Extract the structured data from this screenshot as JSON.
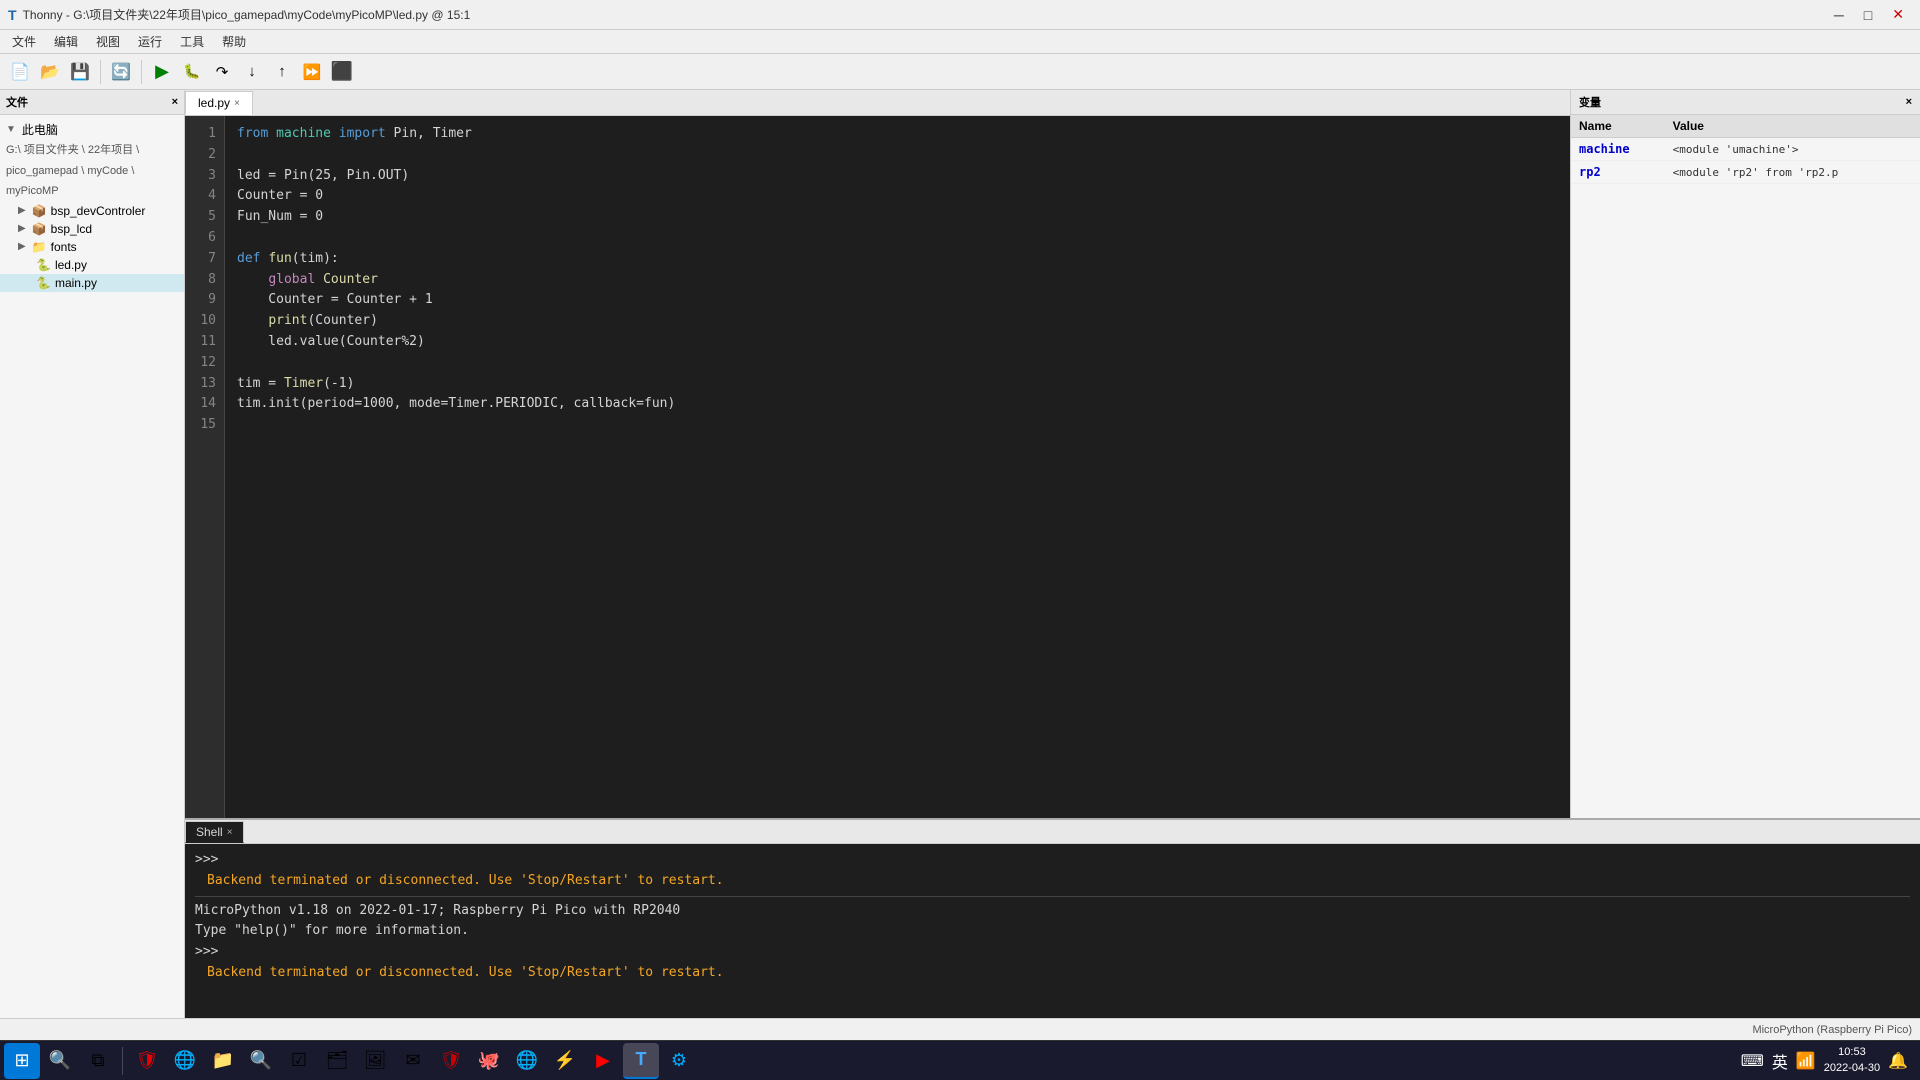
{
  "titleBar": {
    "appName": "Thonny",
    "filePath": "G:\\项目文件夹\\22年项目\\pico_gamepad\\myCode\\myPicoMP\\led.py",
    "position": "15:1",
    "minimizeLabel": "─",
    "maximizeLabel": "□",
    "closeLabel": "✕"
  },
  "menuBar": {
    "items": [
      "文件",
      "编辑",
      "视图",
      "运行",
      "工具",
      "帮助"
    ]
  },
  "toolbar": {
    "buttons": [
      {
        "name": "new-file-btn",
        "icon": "📄",
        "label": "New"
      },
      {
        "name": "open-file-btn",
        "icon": "📂",
        "label": "Open"
      },
      {
        "name": "save-file-btn",
        "icon": "💾",
        "label": "Save"
      },
      {
        "name": "new-debug-btn",
        "icon": "🔧",
        "label": "Debug"
      },
      {
        "name": "run-btn",
        "icon": "▶",
        "label": "Run"
      },
      {
        "name": "debug-btn",
        "icon": "🐞",
        "label": "Debug"
      },
      {
        "name": "step-over-btn",
        "icon": "↷",
        "label": "Step Over"
      },
      {
        "name": "step-into-btn",
        "icon": "↓",
        "label": "Step Into"
      },
      {
        "name": "step-out-btn",
        "icon": "↑",
        "label": "Step Out"
      },
      {
        "name": "resume-btn",
        "icon": "⏩",
        "label": "Resume"
      },
      {
        "name": "stop-btn",
        "icon": "⬛",
        "label": "Stop",
        "isStop": true
      }
    ]
  },
  "sidebar": {
    "header": "文件",
    "thisComputer": "此电脑",
    "path": "G:\\ 项目文件夹 \\ 22年项目 \\",
    "path2": "pico_gamepad \\ myCode \\",
    "path3": "myPicoMP",
    "items": [
      {
        "name": "bsp_devControler",
        "type": "folder",
        "expanded": false,
        "indent": 0
      },
      {
        "name": "bsp_lcd",
        "type": "folder",
        "expanded": false,
        "indent": 0
      },
      {
        "name": "fonts",
        "type": "folder",
        "expanded": false,
        "indent": 0
      },
      {
        "name": "led.py",
        "type": "file-py",
        "active": false,
        "indent": 0
      },
      {
        "name": "main.py",
        "type": "file-py",
        "active": true,
        "indent": 0
      }
    ]
  },
  "editor": {
    "tabs": [
      {
        "label": "led.py",
        "active": true,
        "closeable": true
      }
    ],
    "lines": [
      {
        "num": 1,
        "content": "from machine import Pin, Timer"
      },
      {
        "num": 2,
        "content": ""
      },
      {
        "num": 3,
        "content": "led = Pin(25, Pin.OUT)"
      },
      {
        "num": 4,
        "content": "Counter = 0"
      },
      {
        "num": 5,
        "content": "Fun_Num = 0"
      },
      {
        "num": 6,
        "content": ""
      },
      {
        "num": 7,
        "content": "def fun(tim):"
      },
      {
        "num": 8,
        "content": "    global Counter"
      },
      {
        "num": 9,
        "content": "    Counter = Counter + 1"
      },
      {
        "num": 10,
        "content": "    print(Counter)"
      },
      {
        "num": 11,
        "content": "    led.value(Counter%2)"
      },
      {
        "num": 12,
        "content": ""
      },
      {
        "num": 13,
        "content": "tim = Timer(-1)"
      },
      {
        "num": 14,
        "content": "tim.init(period=1000, mode=Timer.PERIODIC, callback=fun)"
      },
      {
        "num": 15,
        "content": ""
      }
    ]
  },
  "shell": {
    "tabLabel": "Shell",
    "lines": [
      {
        "type": "prompt",
        "text": ">>> "
      },
      {
        "type": "error",
        "text": "Backend terminated or disconnected. Use 'Stop/Restart' to restart."
      },
      {
        "type": "separator"
      },
      {
        "type": "info",
        "text": "MicroPython v1.18 on 2022-01-17; Raspberry Pi Pico with RP2040"
      },
      {
        "type": "info",
        "text": "Type \"help()\" for more information."
      },
      {
        "type": "prompt",
        "text": ">>> "
      },
      {
        "type": "error",
        "text": "Backend terminated or disconnected. Use 'Stop/Restart' to restart."
      }
    ]
  },
  "variables": {
    "header": "变量",
    "columns": [
      "Name",
      "Value"
    ],
    "rows": [
      {
        "name": "machine",
        "value": "<module 'umachine'>"
      },
      {
        "name": "rp2",
        "value": "<module 'rp2' from 'rp2.p"
      }
    ]
  },
  "statusBar": {
    "text": "MicroPython (Raspberry Pi Pico)"
  },
  "taskbar": {
    "startIcon": "⊞",
    "apps": [
      {
        "name": "taskbar-windows",
        "icon": "⊞",
        "label": ""
      },
      {
        "name": "taskbar-search",
        "icon": "🔍",
        "label": ""
      },
      {
        "name": "taskbar-taskview",
        "icon": "⧉",
        "label": ""
      },
      {
        "name": "taskbar-edge",
        "icon": "🌐",
        "label": ""
      },
      {
        "name": "taskbar-explorer",
        "icon": "📁",
        "label": ""
      },
      {
        "name": "taskbar-store",
        "icon": "🛍",
        "label": ""
      },
      {
        "name": "taskbar-thonny",
        "icon": "T",
        "label": "",
        "active": true
      }
    ],
    "tray": {
      "time": "10:53",
      "date": "2022-04-30"
    }
  }
}
